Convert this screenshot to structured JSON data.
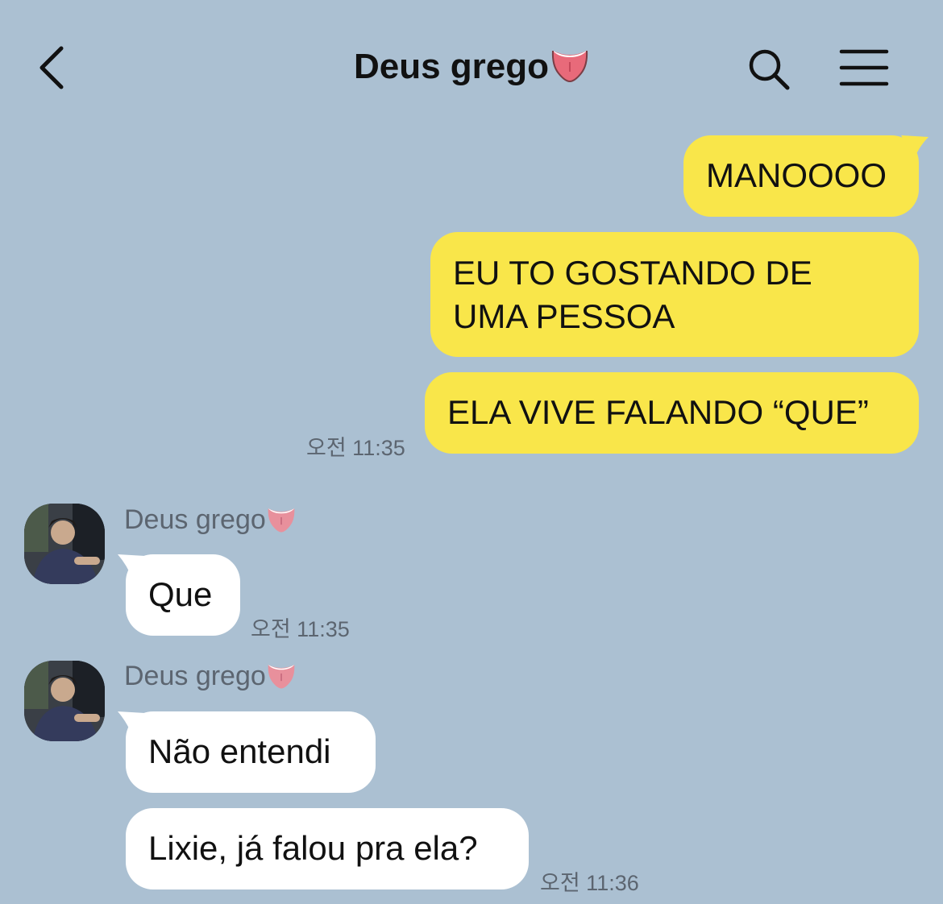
{
  "header": {
    "title": "Deus grego",
    "title_emoji": "tongue-emoji"
  },
  "messages": [
    {
      "from": "me",
      "text": "MANOOOO"
    },
    {
      "from": "me",
      "lines": [
        "EU TO GOSTANDO DE",
        "UMA PESSOA"
      ]
    },
    {
      "from": "me",
      "text": "ELA VIVE FALANDO “QUE”",
      "time": "오전 11:35"
    },
    {
      "from": "other",
      "sender": "Deus grego",
      "text": "Que",
      "time": "오전 11:35"
    },
    {
      "from": "other",
      "sender": "Deus grego",
      "text": "Não entendi"
    },
    {
      "from": "other",
      "text": "Lixie, já falou pra ela?",
      "time": "오전 11:36"
    }
  ],
  "colors": {
    "background": "#abc0d2",
    "my_bubble": "#f9e64a",
    "other_bubble": "#ffffff"
  },
  "icons": [
    "back-arrow-icon",
    "search-icon",
    "menu-icon"
  ]
}
